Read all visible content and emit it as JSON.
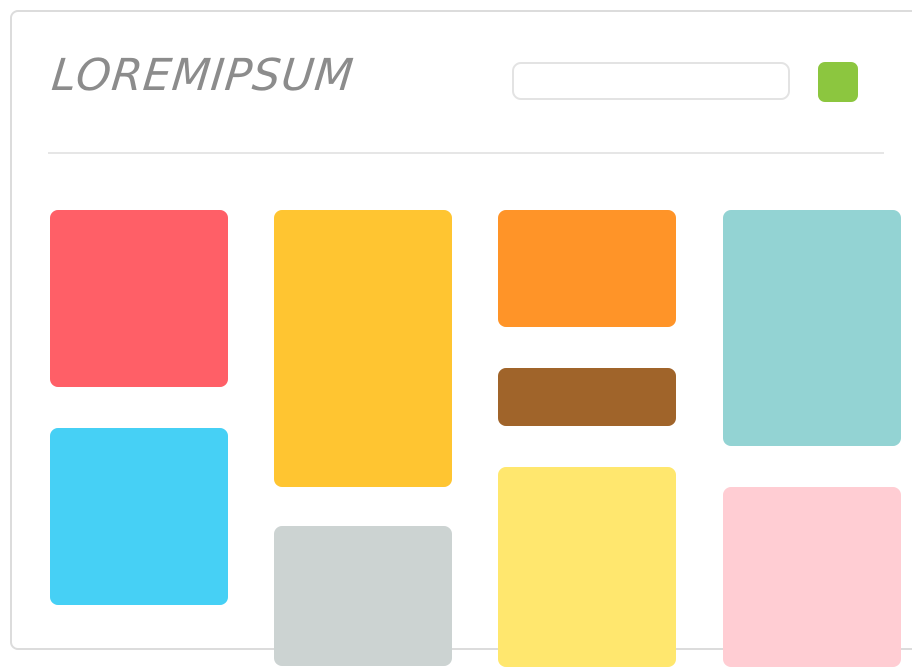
{
  "header": {
    "logo_text": "LOREMIPSUM",
    "search": {
      "value": "",
      "placeholder": ""
    },
    "action_button": {
      "color": "#8cc63f"
    }
  },
  "grid": {
    "tiles": [
      {
        "id": "red",
        "color": "#ff5f67"
      },
      {
        "id": "blue",
        "color": "#46d0f5"
      },
      {
        "id": "yellow",
        "color": "#ffc531"
      },
      {
        "id": "gray",
        "color": "#ccd3d2"
      },
      {
        "id": "orange",
        "color": "#ff9428"
      },
      {
        "id": "brown",
        "color": "#a0642a"
      },
      {
        "id": "light-yellow",
        "color": "#ffe76e"
      },
      {
        "id": "teal",
        "color": "#93d3d3"
      },
      {
        "id": "pink",
        "color": "#ffcdd3"
      }
    ]
  }
}
